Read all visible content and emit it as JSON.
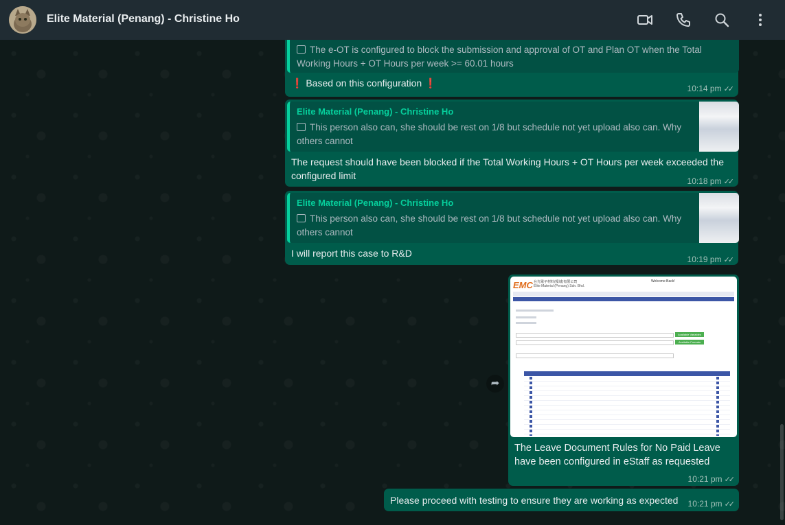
{
  "header": {
    "title": "Elite Material (Penang) - Christine Ho",
    "icons": [
      "video-call-icon",
      "voice-call-icon",
      "search-icon",
      "menu-icon"
    ]
  },
  "messages": [
    {
      "quote_text": "The e-OT is configured to block the submission and approval of OT and Plan OT when the Total Working Hours + OT Hours per week >= 60.01 hours",
      "text": "Based on this configuration",
      "time": "10:14 pm"
    },
    {
      "quote_sender": "Elite Material (Penang) - Christine Ho",
      "quote_text": "This person also can, she should be rest on 1/8 but schedule not yet upload also can. Why others cannot",
      "text": "The request should have been blocked if the Total Working Hours + OT Hours per week exceeded the configured limit",
      "time": "10:18 pm"
    },
    {
      "quote_sender": "Elite Material (Penang) - Christine Ho",
      "quote_text": "This person also can, she should be rest on 1/8 but schedule not yet upload also can. Why others cannot",
      "text": "I will report this case to R&D",
      "time": "10:19 pm"
    },
    {
      "text": "The Leave Document Rules for No Paid Leave have been configured in eStaff as requested",
      "time": "10:21 pm"
    },
    {
      "text": "Please proceed with testing to ensure they are working as expected",
      "time": "10:21 pm"
    }
  ],
  "screenshot": {
    "logo": "EMC",
    "company_cn": "台光電子材料(檳城)有限公司",
    "company_en": "Elite Material (Penang) Sdn. Bhd.",
    "user_text": "Welcome Back!",
    "buttons": [
      "Available Variables",
      "Available Formats"
    ]
  },
  "colors": {
    "bubble": "#005c4b",
    "quote_bar": "#06cf9c",
    "header": "#202c33"
  }
}
